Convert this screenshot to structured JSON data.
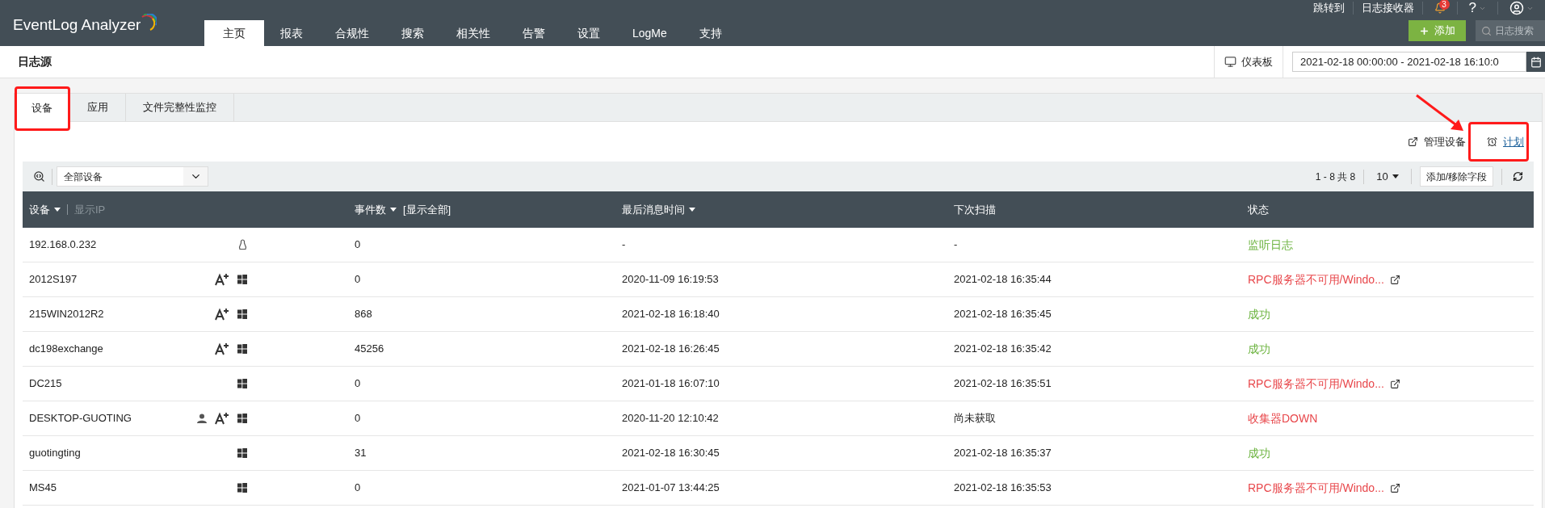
{
  "app": {
    "logo": "EventLog Analyzer"
  },
  "nav": [
    {
      "label": "主页",
      "selected": true
    },
    {
      "label": "报表",
      "selected": false
    },
    {
      "label": "合规性",
      "selected": false
    },
    {
      "label": "搜索",
      "selected": false
    },
    {
      "label": "相关性",
      "selected": false
    },
    {
      "label": "告警",
      "selected": false
    },
    {
      "label": "设置",
      "selected": false
    },
    {
      "label": "LogMe",
      "selected": false
    },
    {
      "label": "支持",
      "selected": false
    }
  ],
  "top_links": [
    "跳转到",
    "日志接收器"
  ],
  "notifications": {
    "count": "3"
  },
  "help": {
    "label": "?"
  },
  "add_button": "添加",
  "log_search": {
    "placeholder": "日志搜索"
  },
  "page": {
    "title": "日志源",
    "dashboard": "仪表板",
    "date_range": "2021-02-18 00:00:00 - 2021-02-18 16:10:0"
  },
  "tabs": [
    {
      "label": "设备",
      "selected": true
    },
    {
      "label": "应用",
      "selected": false
    },
    {
      "label": "文件完整性监控",
      "selected": false
    }
  ],
  "actions": [
    {
      "kind": "manage",
      "label": "管理设备"
    },
    {
      "kind": "schedule",
      "label": "计划"
    }
  ],
  "filter": {
    "value": "全部设备"
  },
  "pagination": {
    "range": "1 - 8 共 8",
    "page_size": "10"
  },
  "columns_button": "添加/移除字段",
  "table": {
    "columns": [
      {
        "label": "设备",
        "sortable": true,
        "extra": "显示IP"
      },
      {
        "label": "事件数",
        "sortable": true,
        "extra": "[显示全部]"
      },
      {
        "label": "最后消息时间",
        "sortable": true
      },
      {
        "label": "下次扫描",
        "sortable": false
      },
      {
        "label": "状态",
        "sortable": false
      }
    ],
    "rows": [
      {
        "device": "192.168.0.232",
        "icons": [
          {
            "kind": "linux"
          }
        ],
        "events": "0",
        "last": "-",
        "next": "-",
        "status": "监听日志",
        "color": "#6cb33f",
        "details": false
      },
      {
        "device": "2012S197",
        "icons": [
          {
            "kind": "agent"
          },
          {
            "kind": "windows"
          }
        ],
        "events": "0",
        "last": "2020-11-09 16:19:53",
        "next": "2021-02-18 16:35:44",
        "status": "RPC服务器不可用/Windo...",
        "color": "#e8474b",
        "details": true
      },
      {
        "device": "215WIN2012R2",
        "icons": [
          {
            "kind": "agent"
          },
          {
            "kind": "windows"
          }
        ],
        "events": "868",
        "last": "2021-02-18 16:18:40",
        "next": "2021-02-18 16:35:45",
        "status": "成功",
        "color": "#6cb33f",
        "details": false
      },
      {
        "device": "dc198exchange",
        "icons": [
          {
            "kind": "agent"
          },
          {
            "kind": "windows"
          }
        ],
        "events": "45256",
        "last": "2021-02-18 16:26:45",
        "next": "2021-02-18 16:35:42",
        "status": "成功",
        "color": "#6cb33f",
        "details": false
      },
      {
        "device": "DC215",
        "icons": [
          {
            "kind": "windows"
          }
        ],
        "events": "0",
        "last": "2021-01-18 16:07:10",
        "next": "2021-02-18 16:35:51",
        "status": "RPC服务器不可用/Windo...",
        "color": "#e8474b",
        "details": true
      },
      {
        "device": "DESKTOP-GUOTING",
        "icons": [
          {
            "kind": "user"
          },
          {
            "kind": "agent"
          },
          {
            "kind": "windows"
          }
        ],
        "events": "0",
        "last": "2020-11-20 12:10:42",
        "next": "尚未获取",
        "status": "收集器DOWN",
        "color": "#e8474b",
        "details": false
      },
      {
        "device": "guotingting",
        "icons": [
          {
            "kind": "windows"
          }
        ],
        "events": "31",
        "last": "2021-02-18 16:30:45",
        "next": "2021-02-18 16:35:37",
        "status": "成功",
        "color": "#6cb33f",
        "details": false
      },
      {
        "device": "MS45",
        "icons": [
          {
            "kind": "windows"
          }
        ],
        "events": "0",
        "last": "2021-01-07 13:44:25",
        "next": "2021-02-18 16:35:53",
        "status": "RPC服务器不可用/Windo...",
        "color": "#e8474b",
        "details": true
      }
    ]
  }
}
